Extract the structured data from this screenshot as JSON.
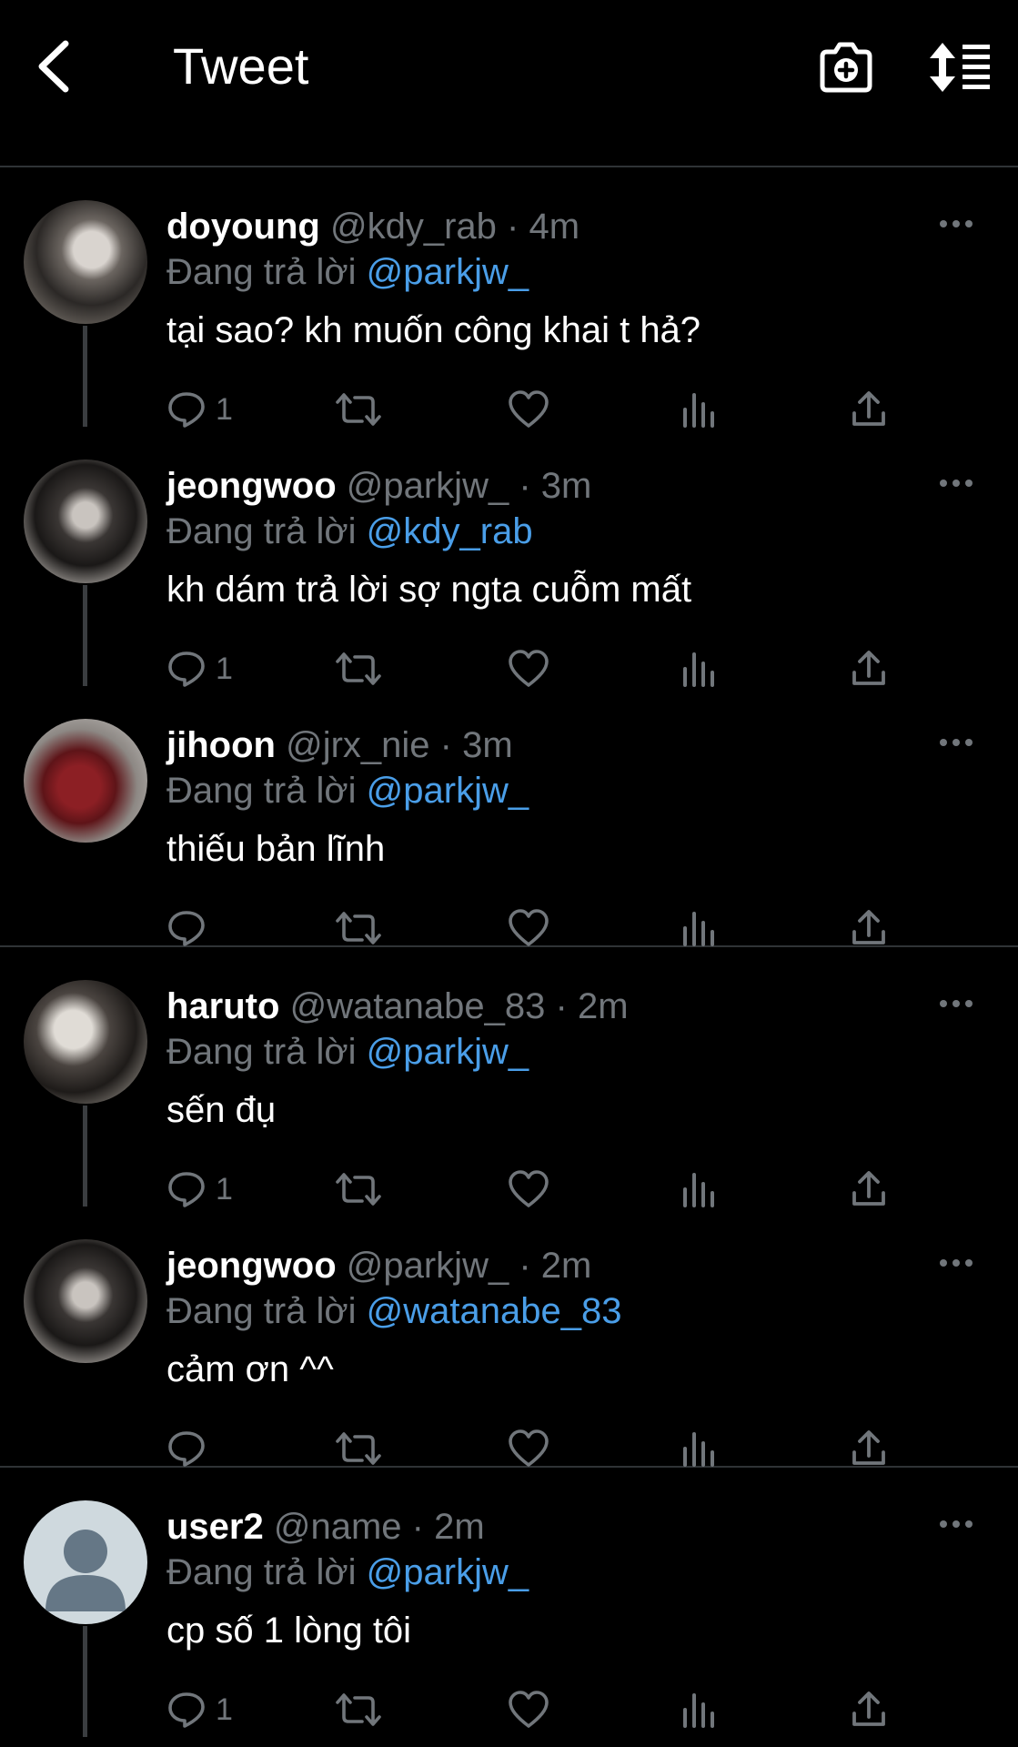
{
  "header": {
    "title": "Tweet",
    "back_icon": "chevron-left-icon",
    "camera_icon": "camera-add-icon",
    "sort_icon": "sort-list-icon"
  },
  "colors": {
    "background": "#000000",
    "mention": "#4a9ee8",
    "muted": "#71767b",
    "divider": "#2f3336"
  },
  "reply_prefix": "Đang trả lời",
  "tweets": [
    {
      "name": "doyoung",
      "handle": "@kdy_rab",
      "time": "4m",
      "reply_to": "@parkjw_",
      "text": "tại sao? kh muốn công khai t hả?",
      "replies": "1"
    },
    {
      "name": "jeongwoo",
      "handle": "@parkjw_",
      "time": "3m",
      "reply_to": "@kdy_rab",
      "text": "kh dám trả lời sợ ngta cuỗm mất",
      "replies": "1"
    },
    {
      "name": "jihoon",
      "handle": "@jrx_nie",
      "time": "3m",
      "reply_to": "@parkjw_",
      "text": "thiếu bản lĩnh",
      "replies": ""
    },
    {
      "name": "haruto",
      "handle": "@watanabe_83",
      "time": "2m",
      "reply_to": "@parkjw_",
      "text": "sến đụ",
      "replies": "1"
    },
    {
      "name": "jeongwoo",
      "handle": "@parkjw_",
      "time": "2m",
      "reply_to": "@watanabe_83",
      "text": "cảm ơn ^^",
      "replies": ""
    },
    {
      "name": "user2",
      "handle": "@name",
      "time": "2m",
      "reply_to": "@parkjw_",
      "text": "cp số 1 lòng tôi",
      "replies": "1"
    }
  ]
}
